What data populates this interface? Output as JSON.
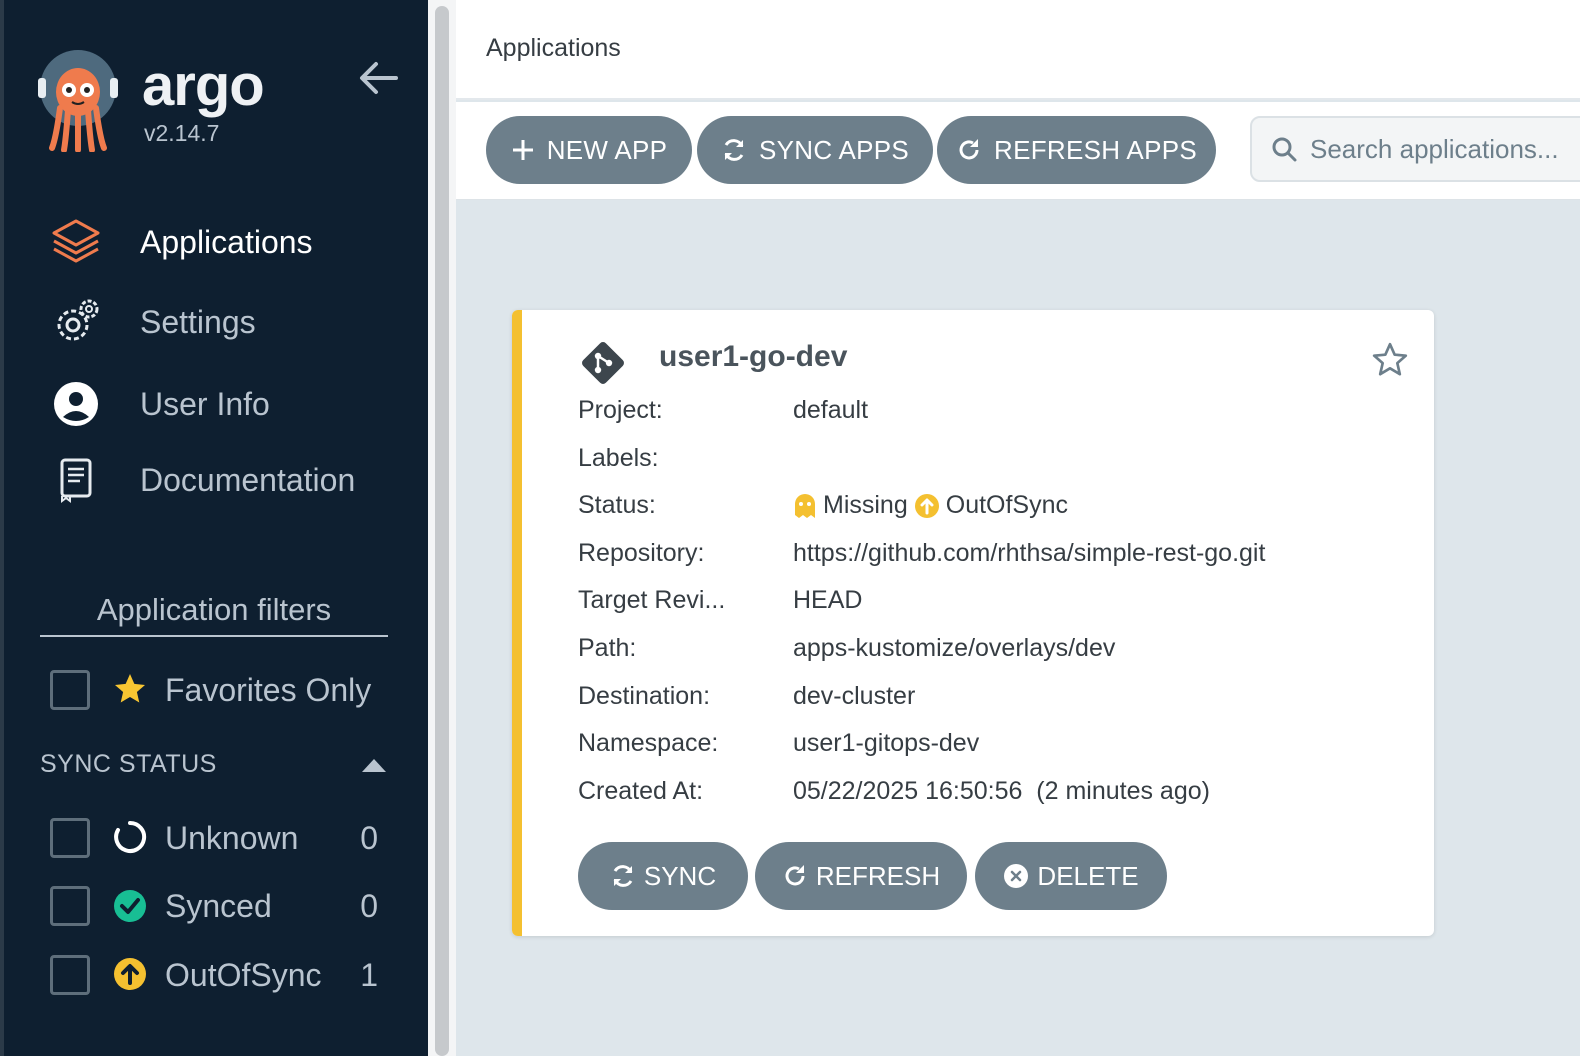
{
  "sidebar": {
    "brand": "argo",
    "version": "v2.14.7",
    "nav": [
      {
        "label": "Applications",
        "icon": "layers-icon",
        "active": true
      },
      {
        "label": "Settings",
        "icon": "gears-icon"
      },
      {
        "label": "User Info",
        "icon": "user-circle-icon"
      },
      {
        "label": "Documentation",
        "icon": "book-icon"
      }
    ],
    "filters_title": "Application filters",
    "favorites_label": "Favorites Only",
    "sync_status_title": "SYNC STATUS",
    "sync_filters": [
      {
        "label": "Unknown",
        "count": "0",
        "icon": "circle-notch-icon"
      },
      {
        "label": "Synced",
        "count": "0",
        "icon": "check-circle-icon",
        "color": "#18be94"
      },
      {
        "label": "OutOfSync",
        "count": "1",
        "icon": "arrow-up-circle-icon",
        "color": "#f4c030"
      }
    ]
  },
  "header": {
    "title": "Applications"
  },
  "toolbar": {
    "new_app": "NEW APP",
    "sync_apps": "SYNC APPS",
    "refresh_apps": "REFRESH APPS",
    "search_placeholder": "Search applications..."
  },
  "app": {
    "name": "user1-go-dev",
    "fields": {
      "project_label": "Project:",
      "project": "default",
      "labels_label": "Labels:",
      "labels": "",
      "status_label": "Status:",
      "health": "Missing",
      "sync": "OutOfSync",
      "repo_label": "Repository:",
      "repo": "https://github.com/rhthsa/simple-rest-go.git",
      "target_label": "Target Revi...",
      "target": "HEAD",
      "path_label": "Path:",
      "path": "apps-kustomize/overlays/dev",
      "dest_label": "Destination:",
      "dest": "dev-cluster",
      "ns_label": "Namespace:",
      "ns": "user1-gitops-dev",
      "created_label": "Created At:",
      "created": "05/22/2025 16:50:56  (2 minutes ago)"
    },
    "actions": {
      "sync": "SYNC",
      "refresh": "REFRESH",
      "delete": "DELETE"
    },
    "accent": "#f4c030"
  }
}
